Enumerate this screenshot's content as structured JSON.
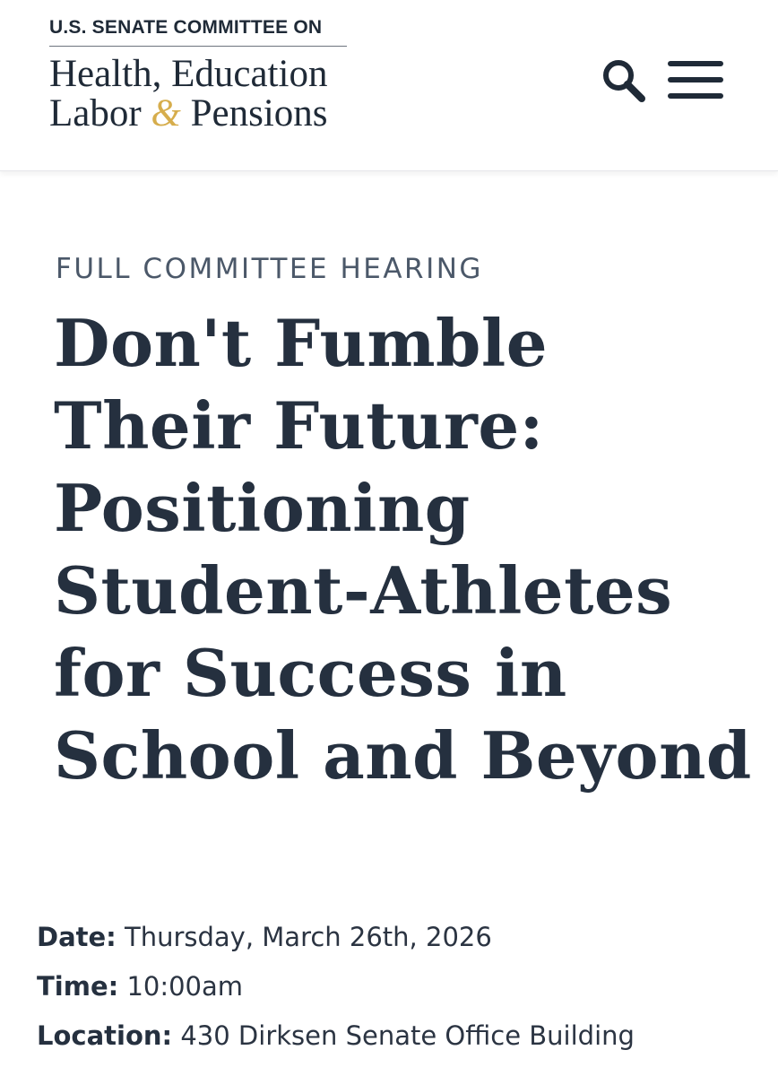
{
  "header": {
    "logo": {
      "top_line": "U.S. SENATE COMMITTEE ON",
      "name_line_1": "Health, Education",
      "name_line_2_a": "Labor",
      "name_line_2_amp": "&",
      "name_line_2_b": "Pensions"
    },
    "search_icon": "search-icon",
    "menu_icon": "hamburger-menu-icon"
  },
  "hearing": {
    "type": "FULL COMMITTEE HEARING",
    "title": "Don't Fumble Their Future: Positioning Student-Athletes for Success in School and Beyond",
    "date_label": "Date:",
    "date_value": "Thursday, March 26th, 2026",
    "time_label": "Time:",
    "time_value": "10:00am",
    "location_label": "Location:",
    "location_value": "430 Dirksen Senate Office Building"
  },
  "colors": {
    "text_navy": "#25303f",
    "accent_gold": "#d6ad4c",
    "eyebrow_gray": "#4b5869"
  }
}
